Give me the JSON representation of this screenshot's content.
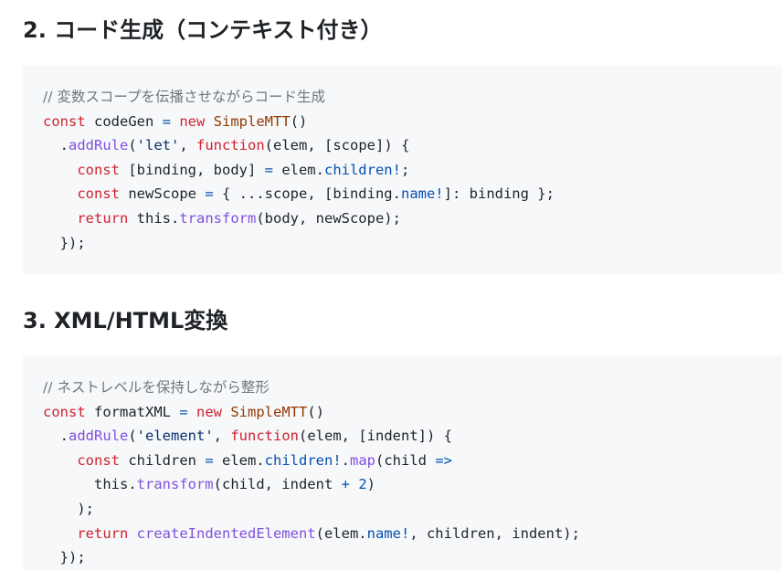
{
  "sections": [
    {
      "heading": "2. コード生成（コンテキスト付き）",
      "code": {
        "comment": "// 変数スコープを伝播させながらコード生成",
        "line1": {
          "kw": "const",
          "name": " codeGen ",
          "op": "=",
          "kw2": " new ",
          "cls": "SimpleMTT",
          "rest": "()"
        },
        "line2": {
          "indent": "  .",
          "fn": "addRule",
          "p1": "(",
          "str": "'let'",
          "p2": ", ",
          "kw": "function",
          "rest": "(elem, [scope]) {"
        },
        "line3": {
          "indent": "    ",
          "kw": "const",
          "a": " [binding, body] ",
          "op": "=",
          "b": " elem.",
          "prop": "children!",
          "c": ";"
        },
        "line4": {
          "indent": "    ",
          "kw": "const",
          "a": " newScope ",
          "op": "=",
          "b": " { ...scope, [binding.",
          "prop": "name!",
          "c": "]: binding };"
        },
        "line5": {
          "indent": "    ",
          "kw": "return",
          "a": " this.",
          "fn": "transform",
          "b": "(body, newScope);"
        },
        "line6": {
          "text": "  });"
        }
      }
    },
    {
      "heading": "3. XML/HTML変換",
      "code": {
        "comment": "// ネストレベルを保持しながら整形",
        "line1": {
          "kw": "const",
          "name": " formatXML ",
          "op": "=",
          "kw2": " new ",
          "cls": "SimpleMTT",
          "rest": "()"
        },
        "line2": {
          "indent": "  .",
          "fn": "addRule",
          "p1": "(",
          "str": "'element'",
          "p2": ", ",
          "kw": "function",
          "rest": "(elem, [indent]) {"
        },
        "line3": {
          "indent": "    ",
          "kw": "const",
          "a": " children ",
          "op": "=",
          "b": " elem.",
          "prop": "children!",
          "c": ".",
          "fn": "map",
          "d": "(child ",
          "op2": "=>"
        },
        "line4": {
          "indent": "      this.",
          "fn": "transform",
          "a": "(child, indent ",
          "op": "+",
          "b": " ",
          "num": "2",
          "c": ")"
        },
        "line5": {
          "text": "    );"
        },
        "line6": {
          "indent": "    ",
          "kw": "return",
          "a": " ",
          "fn": "createIndentedElement",
          "b": "(elem.",
          "prop": "name!",
          "c": ", children, indent);"
        },
        "line7": {
          "text": "  });"
        }
      }
    }
  ]
}
